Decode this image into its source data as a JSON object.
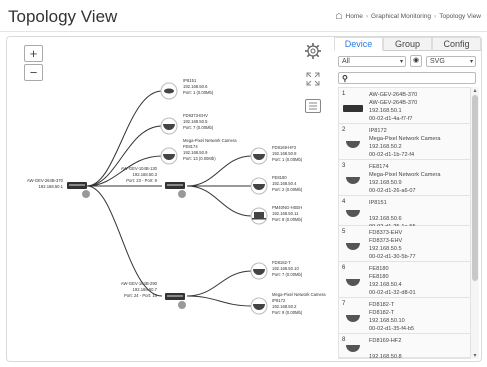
{
  "page": {
    "title": "Topology View"
  },
  "breadcrumb": {
    "home": "Home",
    "parent": "Graphical Monitoring",
    "current": "Topology View"
  },
  "canvas": {
    "zoom_in_label": "+",
    "zoom_out_label": "−",
    "root": {
      "name": "AW-GEV-264B-370",
      "ip": "192.168.50.1"
    },
    "switch_a": {
      "name": "AW-GEV-104B-130",
      "ip": "192.168.50.3",
      "port": "Port: 23 - Port: 9"
    },
    "switch_b": {
      "name": "AW-GEV-104B-290",
      "ip": "192.168.50.7",
      "port": "Port: 24 - Port: 16"
    },
    "devices": [
      {
        "name": "IP8151",
        "ip": "192.168.50.6",
        "port": "Port: 1 (0.00Mb)"
      },
      {
        "name": "FD8373-EHV",
        "ip": "192.168.50.5",
        "port": "Port: 7 (0.00Mb)"
      },
      {
        "name": "Mega-Pixel Network Camera",
        "model": "FE8174",
        "ip": "192.168.50.9",
        "port": "Port: 13 (0.00Mb)"
      },
      {
        "name": "FD8169-HF2",
        "ip": "192.168.50.8",
        "port": "Port: 1 (0.00Mb)"
      },
      {
        "name": "FE8180",
        "ip": "192.168.50.4",
        "port": "Port: 2 (0.00Mb)"
      },
      {
        "name": "PM40NG-HSEH",
        "ip": "192.168.50.11",
        "port": "Port: 8 (0.00Mb)"
      },
      {
        "name": "FD8182-T",
        "ip": "192.168.50.10",
        "port": "Port: 7 (0.00Mb)"
      },
      {
        "name": "Mega-Pixel Network Camera",
        "model": "IP8172",
        "ip": "192.168.50.2",
        "port": "Port: 9 (0.00Mb)"
      }
    ]
  },
  "sidebar": {
    "tabs": [
      "Device",
      "Group",
      "Config"
    ],
    "active_tab": "Device",
    "filter_select": "All",
    "format_select": "SVG",
    "search_placeholder": "",
    "items": [
      {
        "index": "1",
        "lines": [
          "AW-GEV-264B-370",
          "AW-GEV-264B-370",
          "192.168.50.1",
          "00-02-d1-4a-f7-f7"
        ]
      },
      {
        "index": "2",
        "lines": [
          "IP8172",
          "Mega-Pixel Network Camera",
          "192.168.50.2",
          "00-02-d1-1b-72-f4"
        ]
      },
      {
        "index": "3",
        "lines": [
          "FE8174",
          "Mega-Pixel Network Camera",
          "192.168.50.9",
          "00-02-d1-26-a6-07"
        ]
      },
      {
        "index": "4",
        "lines": [
          "IP8151",
          "",
          "192.168.50.6",
          "00-02-d1-25-1e-55"
        ]
      },
      {
        "index": "5",
        "lines": [
          "FD8373-EHV",
          "FD8373-EHV",
          "192.168.50.5",
          "00-02-d1-30-5b-77"
        ]
      },
      {
        "index": "6",
        "lines": [
          "FE8180",
          "FE8180",
          "192.168.50.4",
          "00-02-d1-32-d8-01"
        ]
      },
      {
        "index": "7",
        "lines": [
          "FD8182-T",
          "FD8182-T",
          "192.168.50.10",
          "00-02-d1-35-f4-b5"
        ]
      },
      {
        "index": "8",
        "lines": [
          "FD8169-HF2",
          "",
          "192.168.50.8",
          ""
        ]
      }
    ]
  },
  "colors": {
    "accent": "#2a7ae2",
    "link_line": "#333333",
    "panel_border": "#d9d9d9"
  }
}
